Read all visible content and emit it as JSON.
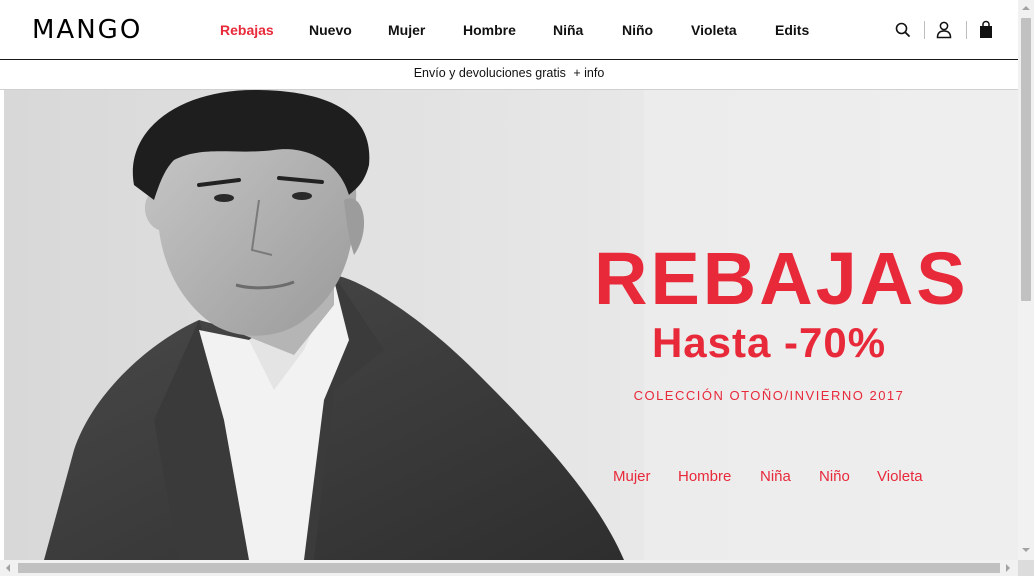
{
  "header": {
    "logo": "MANGO",
    "nav": [
      {
        "label": "Rebajas",
        "active": true
      },
      {
        "label": "Nuevo",
        "active": false
      },
      {
        "label": "Mujer",
        "active": false
      },
      {
        "label": "Hombre",
        "active": false
      },
      {
        "label": "Niña",
        "active": false
      },
      {
        "label": "Niño",
        "active": false
      },
      {
        "label": "Violeta",
        "active": false
      },
      {
        "label": "Edits",
        "active": false
      }
    ],
    "icons": [
      "search-icon",
      "user-icon",
      "shopping-bag-icon"
    ]
  },
  "infobar": {
    "text": "Envío y devoluciones gratis",
    "link": "+ info"
  },
  "hero": {
    "title": "REBAJAS",
    "subtitle": "Hasta -70%",
    "collection": "COLECCIÓN OTOÑO/INVIERNO 2017",
    "categories": [
      "Mujer",
      "Hombre",
      "Niña",
      "Niño",
      "Violeta"
    ]
  },
  "colors": {
    "accent": "#e8293a",
    "text": "#111111",
    "hero_bg": "#eeeeee"
  }
}
